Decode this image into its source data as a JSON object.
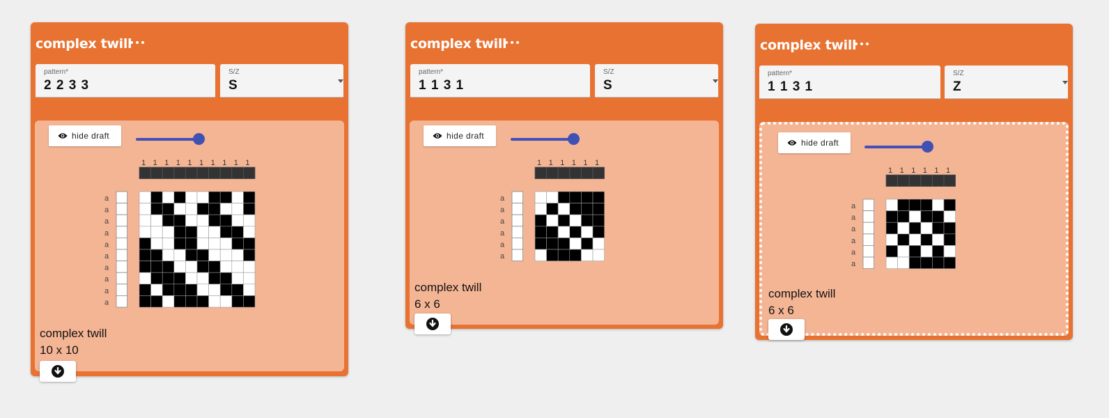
{
  "cards": [
    {
      "title": "complex twill",
      "pattern_label": "pattern*",
      "pattern_value": "2 2 3 3",
      "sz_label": "S/Z",
      "sz_value": "S",
      "hide_label": "hide draft",
      "slider_value": 0.9,
      "caption_name": "complex twill",
      "caption_size": "10 x 10",
      "selected": false,
      "draft": {
        "tieup_labels": [
          "1",
          "1",
          "1",
          "1",
          "1",
          "1",
          "1",
          "1",
          "1",
          "1"
        ],
        "row_labels": [
          "a",
          "a",
          "a",
          "a",
          "a",
          "a",
          "a",
          "a",
          "a",
          "a"
        ],
        "cells": [
          "0101001101",
          "0110011001",
          "0011001100",
          "0001100110",
          "1001100011",
          "1100110001",
          "1110011000",
          "0111001100",
          "1011100110",
          "1101110011"
        ]
      }
    },
    {
      "title": "complex twill",
      "pattern_label": "pattern*",
      "pattern_value": "1 1 3 1",
      "sz_label": "S/Z",
      "sz_value": "S",
      "hide_label": "hide draft",
      "slider_value": 0.9,
      "caption_name": "complex twill",
      "caption_size": "6 x 6",
      "selected": false,
      "draft": {
        "tieup_labels": [
          "1",
          "1",
          "1",
          "1",
          "1",
          "1"
        ],
        "row_labels": [
          "a",
          "a",
          "a",
          "a",
          "a",
          "a"
        ],
        "cells": [
          "001111",
          "010111",
          "101011",
          "110101",
          "111010",
          "011100"
        ]
      }
    },
    {
      "title": "complex twill",
      "pattern_label": "pattern*",
      "pattern_value": "1 1 3 1",
      "sz_label": "S/Z",
      "sz_value": "Z",
      "hide_label": "hide draft",
      "slider_value": 0.9,
      "caption_name": "complex twill",
      "caption_size": "6 x 6",
      "selected": true,
      "draft": {
        "tieup_labels": [
          "1",
          "1",
          "1",
          "1",
          "1",
          "1"
        ],
        "row_labels": [
          "a",
          "a",
          "a",
          "a",
          "a",
          "a"
        ],
        "cells": [
          "011101",
          "110110",
          "101011",
          "010101",
          "101010",
          "001111"
        ]
      }
    }
  ]
}
